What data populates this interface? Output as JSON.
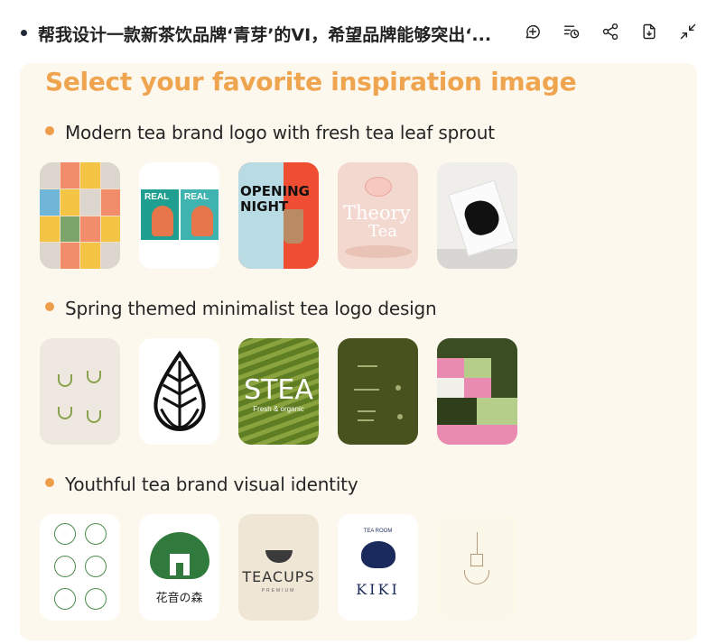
{
  "header": {
    "title": "帮我设计一款新茶饮品牌‘青芽’的VI，希望品牌能够突出‘...",
    "actions": [
      {
        "icon": "plus-circle-icon"
      },
      {
        "icon": "history-list-icon"
      },
      {
        "icon": "share-icon"
      },
      {
        "icon": "export-icon"
      },
      {
        "icon": "collapse-icon"
      }
    ]
  },
  "panel": {
    "title": "Select your favorite inspiration image",
    "sections": [
      {
        "label": "Modern tea brand logo with fresh tea leaf sprout"
      },
      {
        "label": "Spring themed minimalist tea logo design"
      },
      {
        "label": "Youthful tea brand visual identity"
      }
    ]
  },
  "thumb_text": {
    "real": "REAL",
    "opening": "OPENING NIGHT",
    "theory_1": "Theory",
    "theory_2": "Tea",
    "stea": "STEA",
    "stea_sub": "Fresh & organic",
    "tree_cn": "花音の森",
    "teacups": "TEACUPS",
    "teacups_sub": "PREMIUM",
    "kiki": "KIKI",
    "kiki_top": "TEA ROOM"
  },
  "colors": {
    "accent_title": "#efa54f",
    "bullet": "#ee9d4b",
    "panel_bg": "#fdf8ee"
  }
}
